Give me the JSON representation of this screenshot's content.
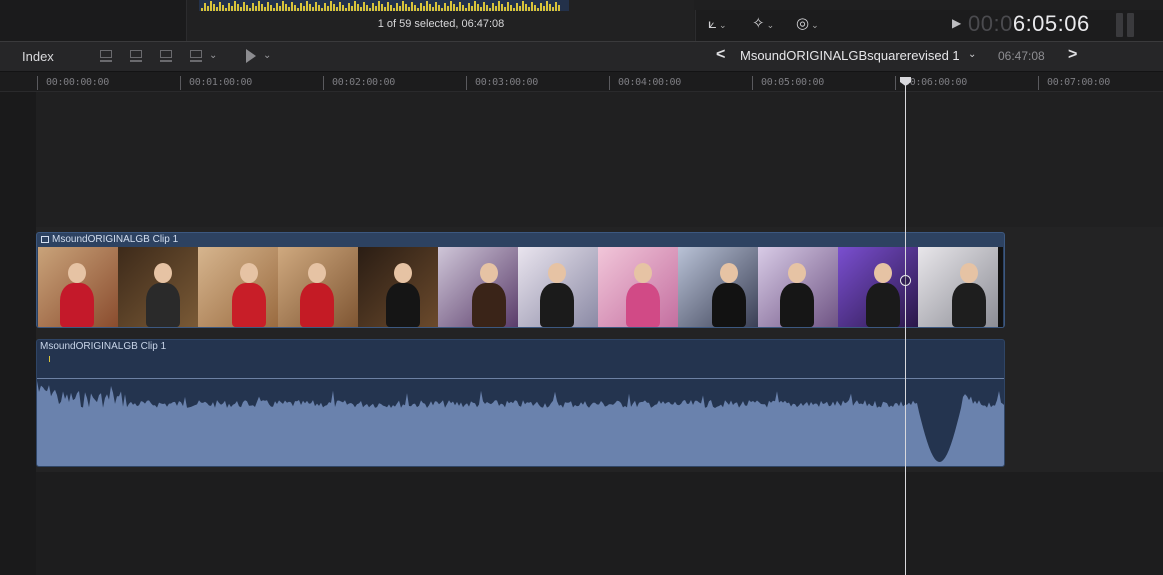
{
  "browser": {
    "selection_status": "1 of 59 selected, 06:47:08"
  },
  "viewer": {
    "timecode_dim": "00:0",
    "timecode_bright": "6:05:06",
    "icons": [
      "crop-transform-icon",
      "magic-wand-icon",
      "speed-retime-icon",
      "play-icon"
    ]
  },
  "toolbar": {
    "index_label": "Index",
    "project_name": "MsoundORIGINALGBsquarerevised 1",
    "project_duration": "06:47:08",
    "prev_label": "<",
    "next_label": ">"
  },
  "ruler": {
    "labels": [
      "00:00:00:00",
      "00:01:00:00",
      "00:02:00:00",
      "00:03:00:00",
      "00:04:00:00",
      "00:05:00:00",
      "00:06:00:00",
      "00:07:00:00"
    ]
  },
  "timeline": {
    "video_clip_label": "MsoundORIGINALGB Clip 1",
    "audio_clip_label": "MsoundORIGINALGB Clip 1"
  },
  "colors": {
    "accent": "#2d4261",
    "audio": "#6a82ad",
    "waveform_peak": "#d8c33a"
  }
}
